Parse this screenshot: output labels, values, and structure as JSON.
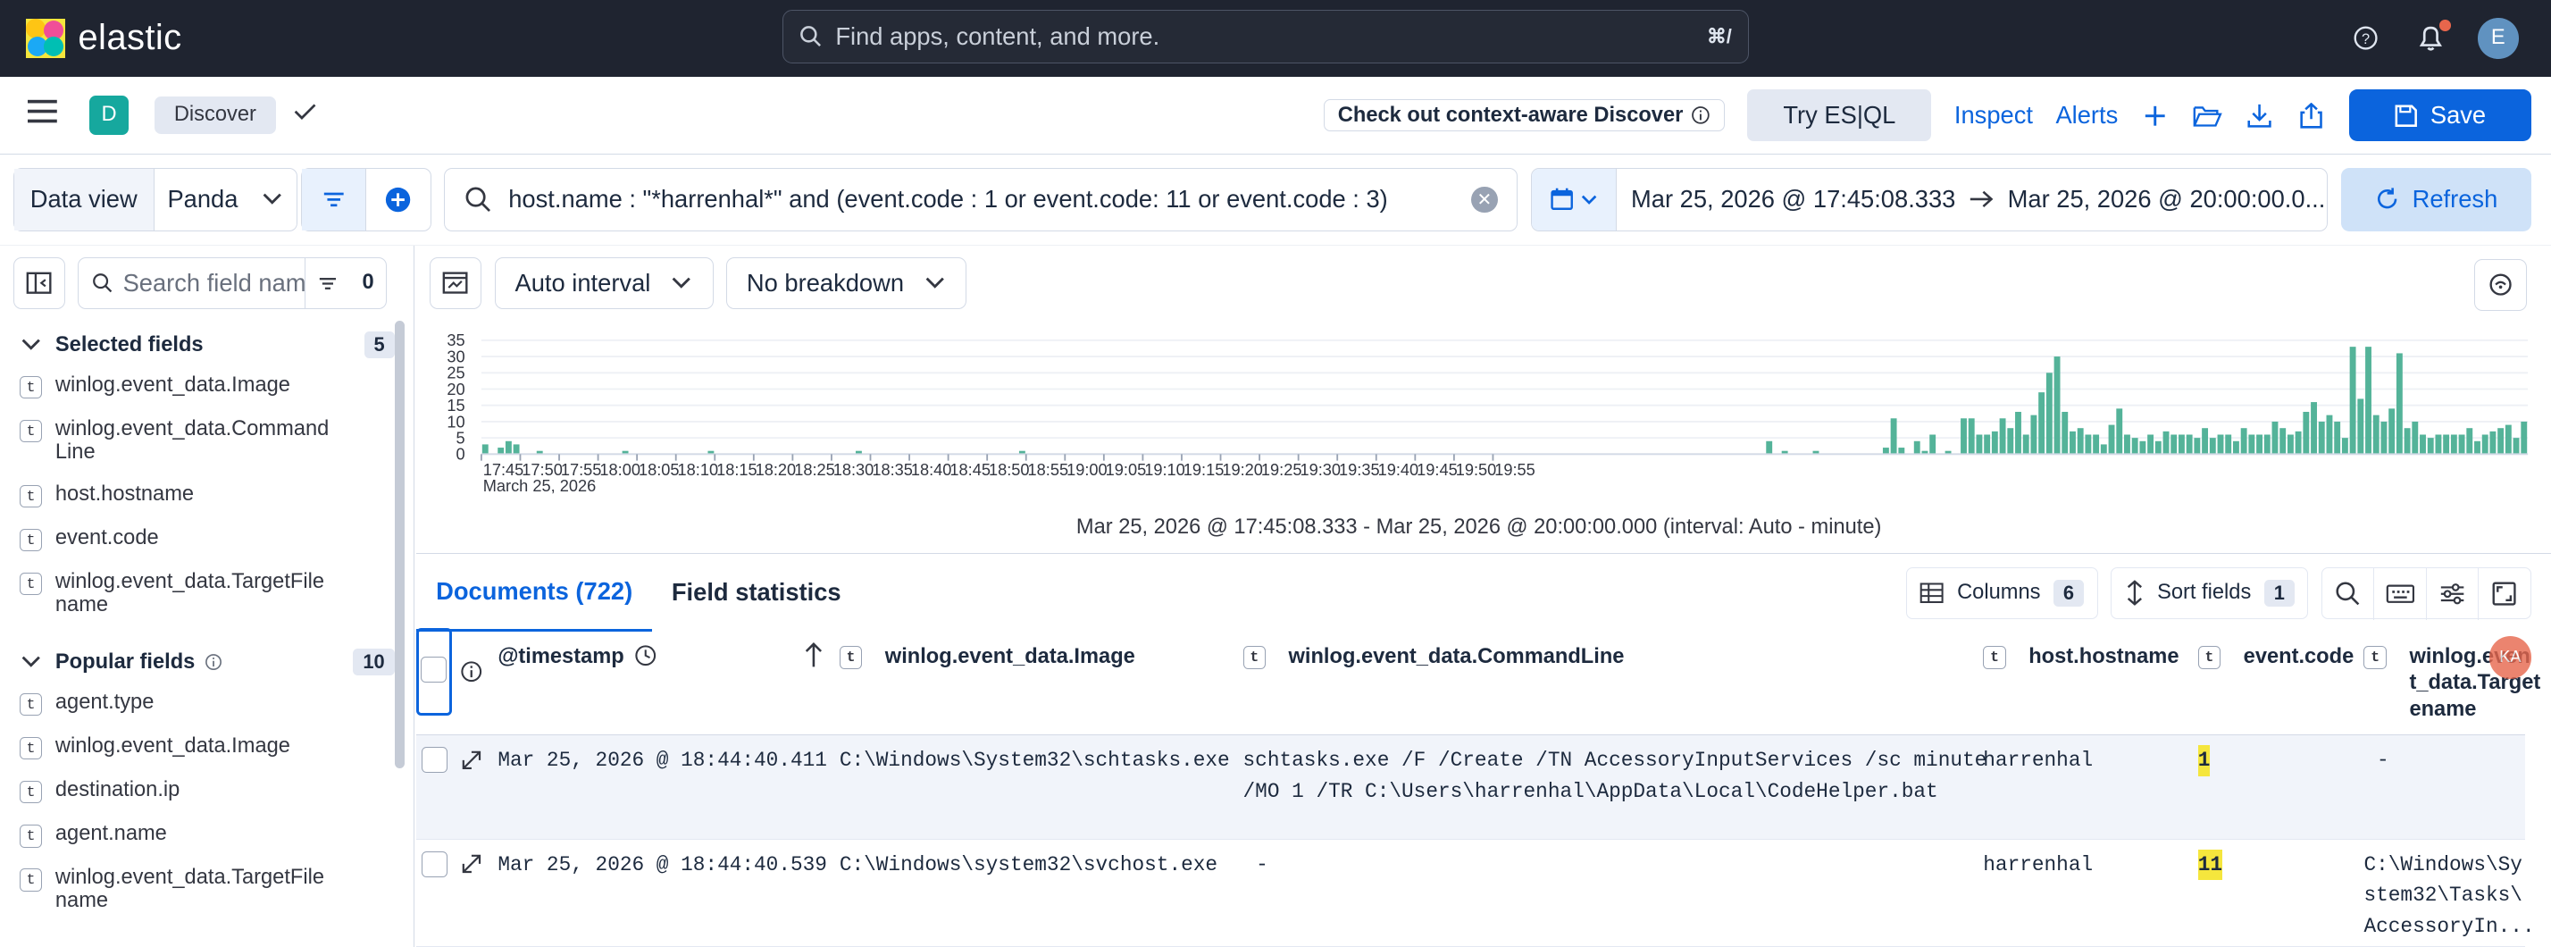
{
  "topbar": {
    "brand": "elastic",
    "search_placeholder": "Find apps, content, and more.",
    "search_shortcut": "⌘/",
    "avatar_initial": "E"
  },
  "appbar": {
    "space_initial": "D",
    "breadcrumb": "Discover",
    "callout": "Check out context-aware Discover",
    "try_esql": "Try ES|QL",
    "inspect": "Inspect",
    "alerts": "Alerts",
    "save": "Save"
  },
  "query": {
    "data_view_label": "Data view",
    "data_view_value": "Panda",
    "kql": "host.name : \"*harrenhal*\" and (event.code : 1 or event.code: 11 or event.code : 3)",
    "date_start": "Mar 25, 2026 @ 17:45:08.333",
    "date_end": "Mar 25, 2026 @ 20:00:00.0...",
    "refresh": "Refresh"
  },
  "sidebar": {
    "search_placeholder": "Search field names",
    "filter_count": "0",
    "selected_title": "Selected fields",
    "selected_count": "5",
    "selected_fields": [
      "winlog.event_data.Image",
      "winlog.event_data.CommandLine",
      "host.hostname",
      "event.code",
      "winlog.event_data.TargetFilename"
    ],
    "popular_title": "Popular fields",
    "popular_count": "10",
    "popular_fields": [
      "agent.type",
      "winlog.event_data.Image",
      "destination.ip",
      "agent.name",
      "winlog.event_data.TargetFilename"
    ]
  },
  "chart_tools": {
    "interval": "Auto interval",
    "breakdown": "No breakdown"
  },
  "chart_data": {
    "type": "bar",
    "ylim": [
      0,
      35
    ],
    "yticks": [
      0,
      5,
      10,
      15,
      20,
      25,
      30,
      35
    ],
    "xticks": [
      "17:45",
      "17:50",
      "17:55",
      "18:00",
      "18:05",
      "18:10",
      "18:15",
      "18:20",
      "18:25",
      "18:30",
      "18:35",
      "18:40",
      "18:45",
      "18:50",
      "18:55",
      "19:00",
      "19:05",
      "19:10",
      "19:15",
      "19:20",
      "19:25",
      "19:30",
      "19:35",
      "19:40",
      "19:45",
      "19:50",
      "19:55"
    ],
    "x_sublabel": "March 25, 2026",
    "color": "#54b399",
    "values": [
      3,
      0,
      2,
      4,
      3,
      0,
      0,
      1,
      0,
      0,
      0,
      0,
      0,
      0,
      0,
      0,
      0,
      0,
      1,
      0,
      0,
      0,
      0,
      0,
      0,
      0,
      0,
      0,
      0,
      1,
      0,
      0,
      0,
      0,
      0,
      0,
      0,
      0,
      0,
      0,
      0,
      0,
      0,
      0,
      0,
      0,
      0,
      0,
      1,
      0,
      0,
      0,
      0,
      0,
      0,
      0,
      0,
      0,
      0,
      0,
      0,
      0,
      0,
      0,
      0,
      0,
      0,
      0,
      0,
      1,
      0,
      0,
      0,
      0,
      0,
      0,
      0,
      0,
      0,
      0,
      0,
      0,
      0,
      0,
      0,
      0,
      0,
      0,
      0,
      0,
      0,
      0,
      0,
      0,
      0,
      0,
      0,
      0,
      0,
      0,
      0,
      0,
      0,
      0,
      0,
      0,
      0,
      0,
      0,
      0,
      0,
      0,
      0,
      0,
      0,
      0,
      0,
      0,
      0,
      0,
      0,
      0,
      0,
      0,
      0,
      0,
      0,
      0,
      0,
      0,
      0,
      0,
      0,
      0,
      0,
      0,
      0,
      0,
      0,
      0,
      0,
      0,
      0,
      0,
      0,
      0,
      0,
      0,
      0,
      0,
      0,
      0,
      0,
      0,
      0,
      0,
      0,
      0,
      0,
      0,
      0,
      0,
      0,
      0,
      0,
      4,
      0,
      1,
      0,
      0,
      0,
      1,
      0,
      0,
      0,
      0,
      0,
      0,
      0,
      0,
      2,
      11,
      2,
      0,
      4,
      1,
      6,
      0,
      1,
      0,
      11,
      11,
      6,
      6,
      7,
      11,
      8,
      13,
      6,
      12,
      19,
      25,
      30,
      13,
      7,
      8,
      6,
      6,
      3,
      9,
      14,
      6,
      5,
      4,
      6,
      4,
      7,
      6,
      6,
      6,
      5,
      8,
      5,
      6,
      6,
      4,
      8,
      6,
      6,
      6,
      10,
      8,
      6,
      7,
      13,
      16,
      10,
      12,
      10,
      5,
      33,
      17,
      33,
      12,
      10,
      14,
      31,
      8,
      10,
      6,
      5,
      6,
      6,
      6,
      6,
      8,
      4,
      6,
      7,
      8,
      9,
      5,
      10
    ],
    "axis_note": "Mar 25, 2026 @ 17:45:08.333 - Mar 25, 2026 @ 20:00:00.000 (interval: Auto - minute)"
  },
  "tabs": {
    "documents": "Documents (722)",
    "field_stats": "Field statistics",
    "columns": "Columns",
    "columns_count": "6",
    "sort": "Sort fields",
    "sort_count": "1"
  },
  "grid": {
    "columns": [
      "@timestamp",
      "winlog.event_data.Image",
      "winlog.event_data.CommandLine",
      "host.hostname",
      "event.code",
      "winlog.event_data.TargetFilename"
    ],
    "col6_header_lines": [
      "winlog.even",
      "t_data.Target",
      "ename"
    ],
    "rows": [
      {
        "timestamp": "Mar 25, 2026 @ 18:44:40.411",
        "image": "C:\\Windows\\System32\\schtasks.exe",
        "cmd_line1": "schtasks.exe /F /Create /TN AccessoryInputServices /sc minute",
        "cmd_line2": "/MO 1 /TR C:\\Users\\harrenhal\\AppData\\Local\\CodeHelper.bat",
        "host": "harrenhal",
        "code": "1",
        "target1": "-",
        "target2": "",
        "target3": ""
      },
      {
        "timestamp": "Mar 25, 2026 @ 18:44:40.539",
        "image": "C:\\Windows\\system32\\svchost.exe",
        "cmd_line1": "-",
        "cmd_line2": "",
        "host": "harrenhal",
        "code": "11",
        "target1": "C:\\Windows\\Sy",
        "target2": "stem32\\Tasks\\",
        "target3": "AccessoryIn..."
      }
    ]
  }
}
